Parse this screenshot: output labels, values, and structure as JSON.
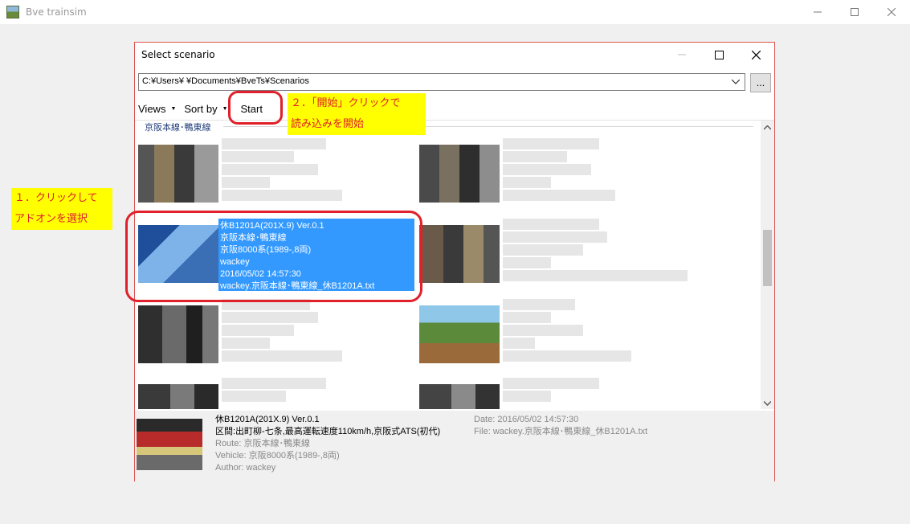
{
  "app": {
    "title": "Bve trainsim"
  },
  "dialog": {
    "title": "Select scenario",
    "path": "C:¥Users¥     ¥Documents¥BveTs¥Scenarios",
    "browse_label": "...",
    "toolbar": {
      "views": "Views",
      "sort_by": "Sort by",
      "start": "Start"
    }
  },
  "list": {
    "group_header": "京阪本線･鴨東線",
    "selected": {
      "lines": [
        "休B1201A(201X.9) Ver.0.1",
        "京阪本線･鴨東線",
        "京阪8000系(1989-,8両)",
        "wackey",
        "2016/05/02 14:57:30",
        "wackey.京阪本線･鴨東線_休B1201A.txt"
      ]
    }
  },
  "details": {
    "title": "休B1201A(201X.9) Ver.0.1",
    "description": "区間:出町柳-七条,最高運転速度110km/h,京阪式ATS(初代)",
    "route": "Route: 京阪本線･鴨東線",
    "vehicle": "Vehicle: 京阪8000系(1989-,8両)",
    "author": "Author: wackey",
    "date": "Date: 2016/05/02 14:57:30",
    "file": "File: wackey.京阪本線･鴨東線_休B1201A.txt"
  },
  "annotations": {
    "step1_line1": "１．クリックして",
    "step1_line2": "アドオンを選択",
    "step2_line1": "２．「開始」クリックで",
    "step2_line2": "読み込みを開始"
  }
}
